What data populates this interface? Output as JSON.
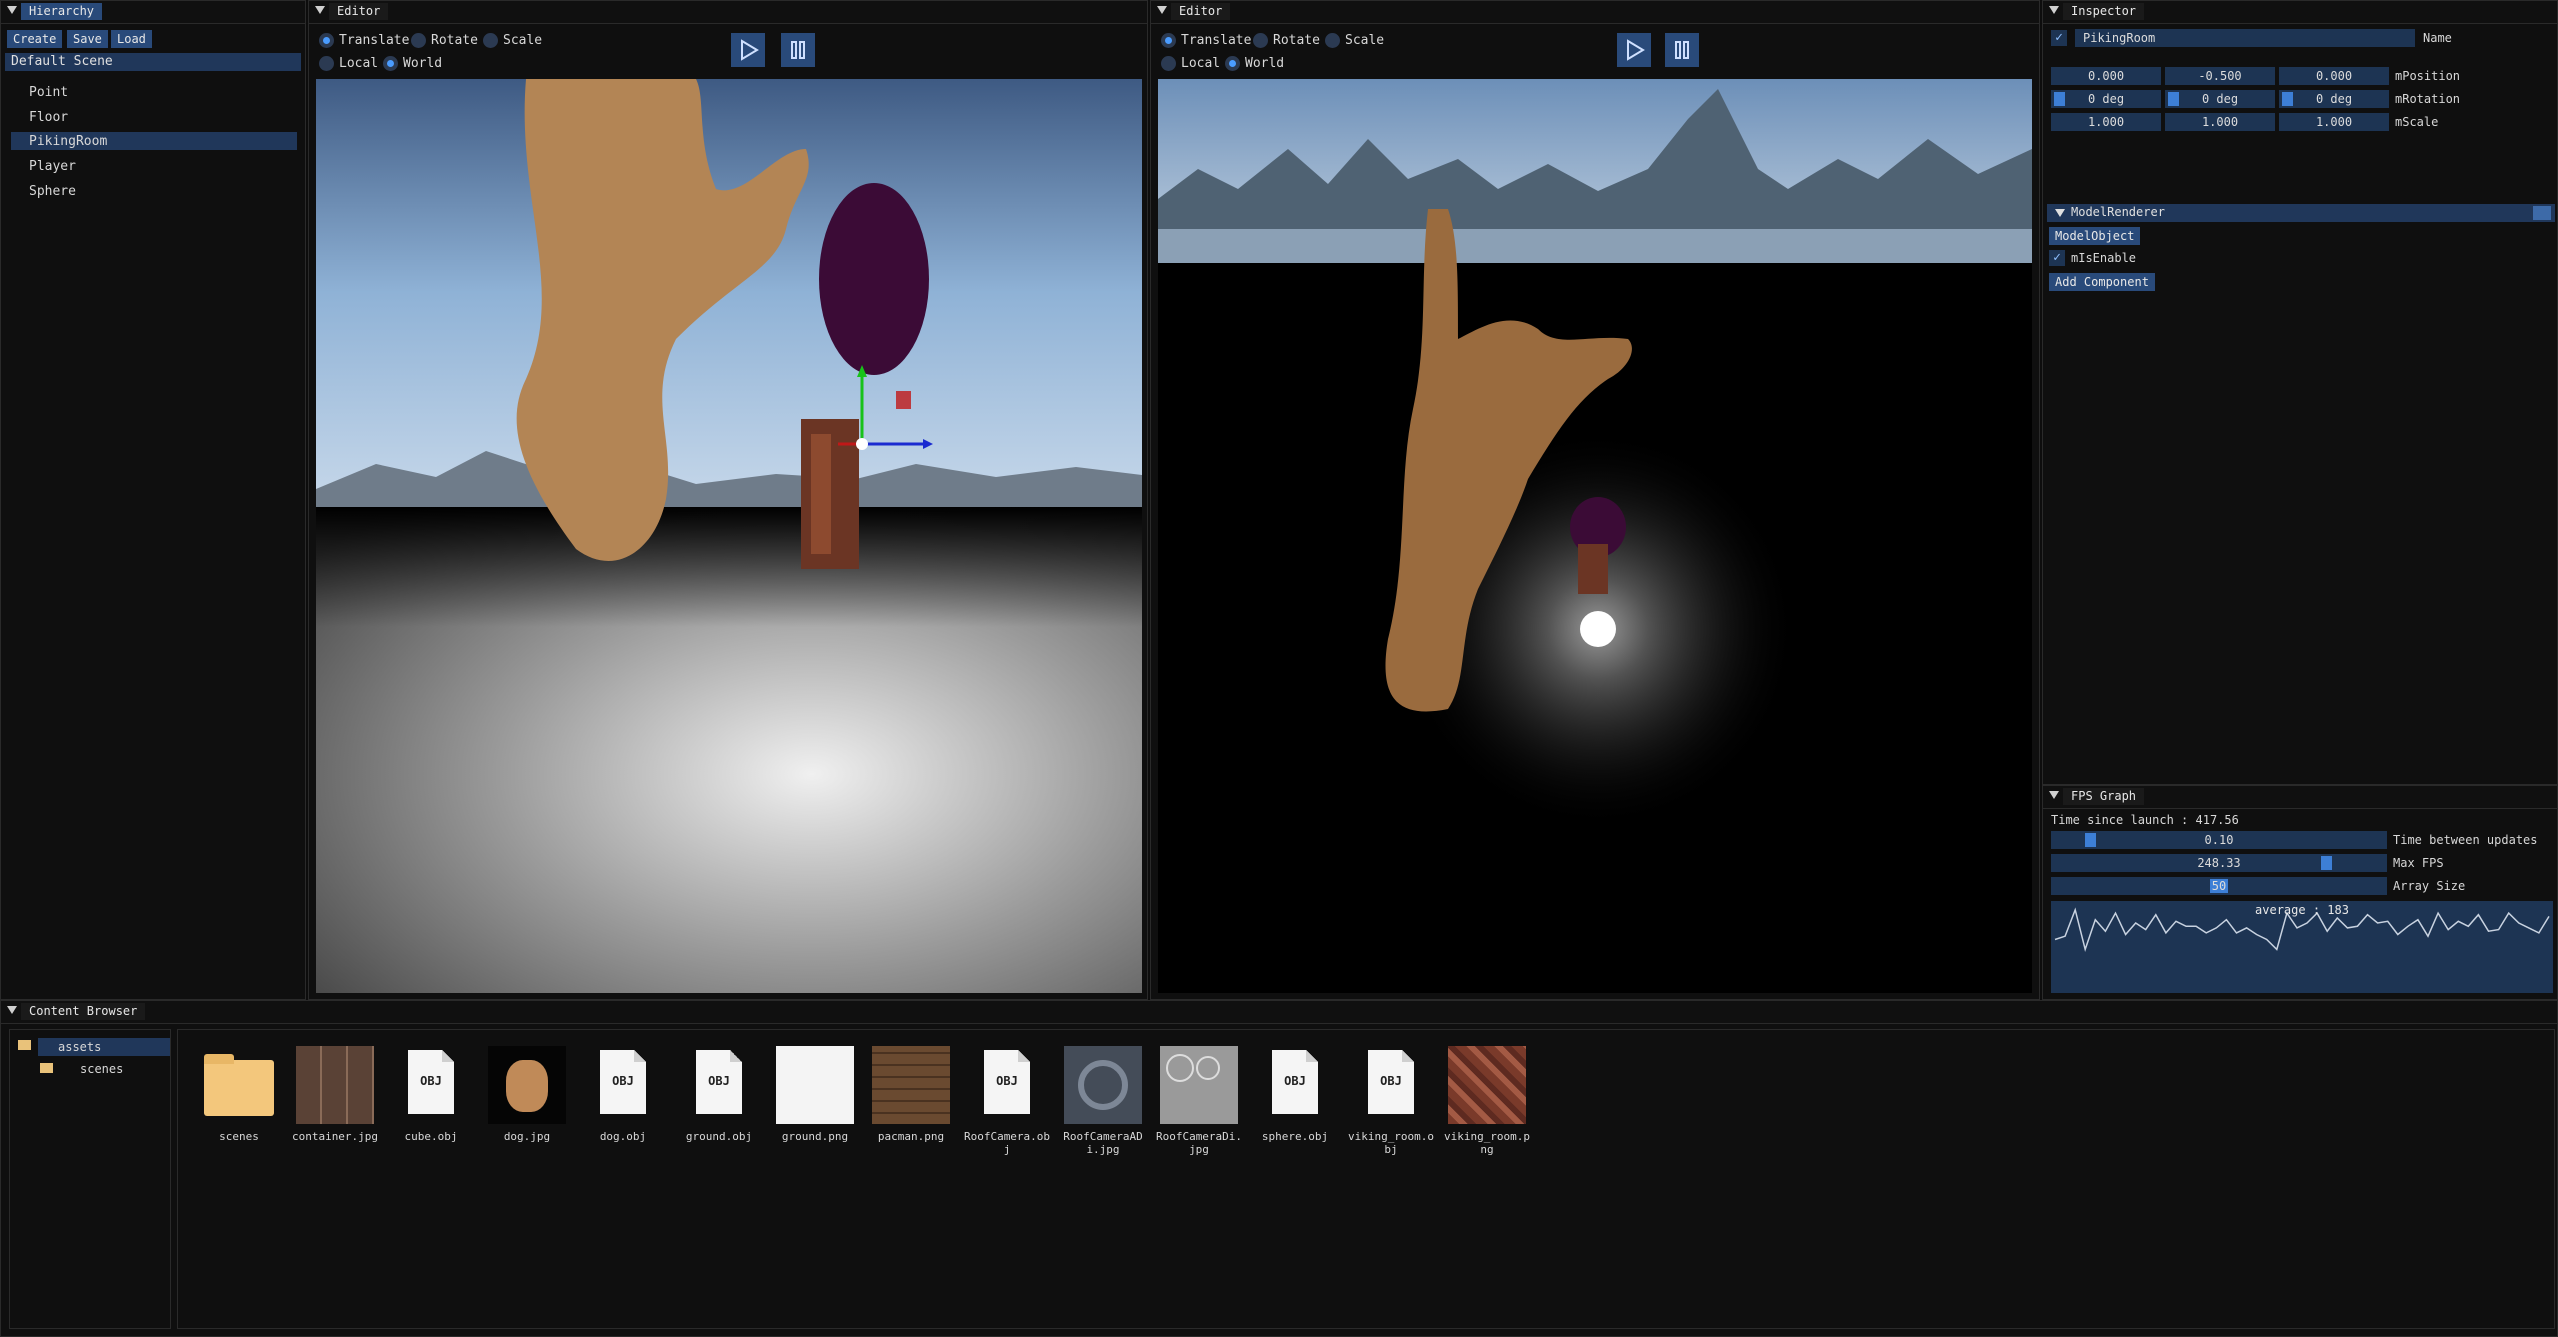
{
  "hierarchy": {
    "title": "Hierarchy",
    "buttons": {
      "create": "Create",
      "save": "Save",
      "load": "Load"
    },
    "scene": "Default Scene",
    "items": [
      "Point",
      "Floor",
      "PikingRoom",
      "Player",
      "Sphere"
    ],
    "selected": "PikingRoom"
  },
  "editor_left": {
    "title": "Editor",
    "modes": {
      "translate": "Translate",
      "rotate": "Rotate",
      "scale": "Scale"
    },
    "spaces": {
      "local": "Local",
      "world": "World"
    },
    "active_mode": "Translate",
    "active_space": "World"
  },
  "editor_right": {
    "title": "Editor",
    "modes": {
      "translate": "Translate",
      "rotate": "Rotate",
      "scale": "Scale"
    },
    "spaces": {
      "local": "Local",
      "world": "World"
    },
    "active_mode": "Translate",
    "active_space": "World"
  },
  "inspector": {
    "title": "Inspector",
    "object_name": "PikingRoom",
    "name_label": "Name",
    "position": {
      "x": "0.000",
      "y": "-0.500",
      "z": "0.000",
      "label": "mPosition"
    },
    "rotation": {
      "x": "0 deg",
      "y": "0 deg",
      "z": "0 deg",
      "label": "mRotation"
    },
    "scale": {
      "x": "1.000",
      "y": "1.000",
      "z": "1.000",
      "label": "mScale"
    },
    "component": {
      "title": "ModelRenderer",
      "object_button": "ModelObject",
      "enable_label": "mIsEnable",
      "enabled": true
    },
    "add_component": "Add Component"
  },
  "fps_graph": {
    "title": "FPS Graph",
    "time_since_launch": "Time since launch : 417.56",
    "time_between_updates": {
      "value": "0.10",
      "label": "Time between updates"
    },
    "max_fps": {
      "value": "248.33",
      "label": "Max FPS"
    },
    "array_size": {
      "value": "50",
      "label": "Array Size"
    },
    "average": "average : 183",
    "samples": [
      150,
      160,
      240,
      120,
      210,
      175,
      230,
      165,
      200,
      180,
      225,
      170,
      205,
      190,
      190,
      170,
      185,
      210,
      170,
      185,
      165,
      150,
      120,
      230,
      185,
      200,
      230,
      175,
      215,
      185,
      190,
      225,
      200,
      205,
      165,
      190,
      210,
      160,
      230,
      180,
      205,
      190,
      225,
      175,
      180,
      230,
      200,
      185,
      170,
      220
    ],
    "line_color": "#c8d2e0",
    "bg_color": "#1d3453"
  },
  "content_browser": {
    "title": "Content Browser",
    "tree": {
      "root": "assets",
      "child": "scenes"
    },
    "files": [
      {
        "name": "scenes",
        "icon": "folder-icon"
      },
      {
        "name": "container.jpg",
        "icon": "crate-texture-icon"
      },
      {
        "name": "cube.obj",
        "icon": "obj-file-icon"
      },
      {
        "name": "dog.jpg",
        "icon": "dog-texture-icon"
      },
      {
        "name": "dog.obj",
        "icon": "obj-file-icon"
      },
      {
        "name": "ground.obj",
        "icon": "obj-file-icon"
      },
      {
        "name": "ground.png",
        "icon": "ground-texture-icon"
      },
      {
        "name": "pacman.png",
        "icon": "wood-texture-icon"
      },
      {
        "name": "RoofCamera.obj",
        "icon": "obj-file-icon"
      },
      {
        "name": "RoofCameraADi.jpg",
        "icon": "camera-texture-icon"
      },
      {
        "name": "RoofCameraDi.jpg",
        "icon": "camera-diffuse-icon"
      },
      {
        "name": "sphere.obj",
        "icon": "obj-file-icon"
      },
      {
        "name": "viking_room.obj",
        "icon": "obj-file-icon"
      },
      {
        "name": "viking_room.png",
        "icon": "viking-texture-icon"
      }
    ]
  },
  "colors": {
    "accent": "#294a7a",
    "highlight": "#4a9cff",
    "field_bg": "#1d3453",
    "sphere": "#3b0b36"
  }
}
